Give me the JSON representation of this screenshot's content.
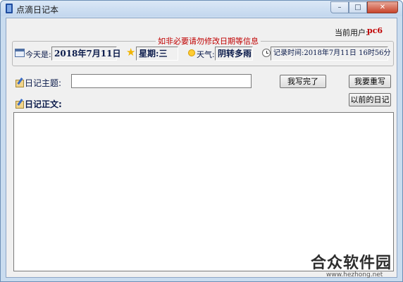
{
  "window": {
    "title": "点滴日记本",
    "controls": {
      "minimize": "–",
      "maximize": "□",
      "close": "✕"
    }
  },
  "header": {
    "user_label": "当前用户:",
    "user_name": "pc6"
  },
  "info_group": {
    "legend": "如非必要请勿修改日期等信息",
    "today_label": "今天是:",
    "today_value": "2018年7月11日",
    "weekday_label": "星期:",
    "weekday_value": "三",
    "weather_label": "天气:",
    "weather_value": "阴转多雨",
    "record_time_label": "记录时间:",
    "record_time_value": "2018年7月11日  16时56分"
  },
  "subject": {
    "label": "日记主题:",
    "value": ""
  },
  "buttons": {
    "done": "我写完了",
    "rewrite": "我要重写",
    "previous": "以前的日记"
  },
  "body": {
    "label": "日记正文:",
    "value": ""
  },
  "watermark": {
    "brand": "合众软件园",
    "url": "www.hezhong.net"
  },
  "icons": {
    "app": "diary-book-icon",
    "calendar": "calendar-icon",
    "star": "star-icon",
    "weather": "sun-icon",
    "clock": "clock-icon",
    "subject": "pen-note-icon",
    "body": "pen-note-icon"
  }
}
